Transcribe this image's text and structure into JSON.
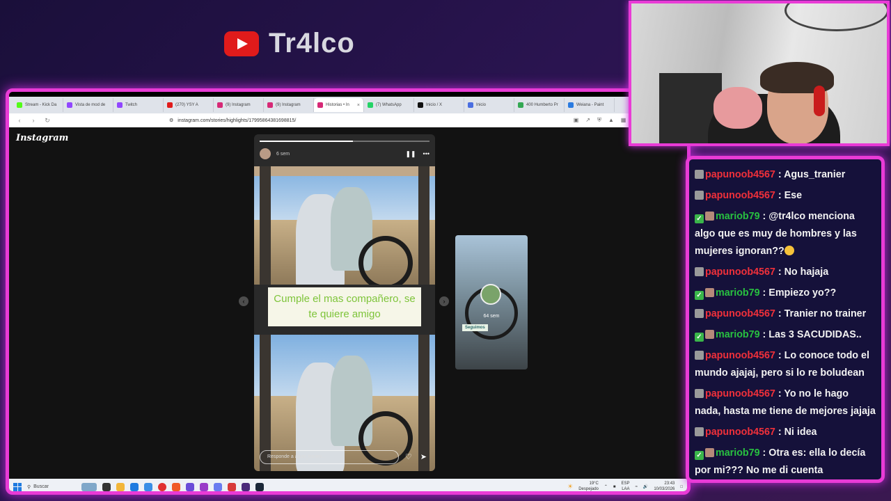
{
  "brand": {
    "name": "Tr4lco",
    "icon": "youtube-icon",
    "accent": "#e01b1b"
  },
  "frame_color": "#e93bd6",
  "browser": {
    "tabs": [
      {
        "label": "Stream - Kick Da",
        "color": "#53fc18",
        "active": false
      },
      {
        "label": "Vista de mod de",
        "color": "#9146ff",
        "active": false
      },
      {
        "label": "Twitch",
        "color": "#9146ff",
        "active": false
      },
      {
        "label": "(270) YSY A",
        "color": "#e01b1b",
        "active": false
      },
      {
        "label": "(9) Instagram",
        "color": "#d62976",
        "active": false
      },
      {
        "label": "(9) Instagram",
        "color": "#d62976",
        "active": false
      },
      {
        "label": "Historias • In",
        "color": "#d62976",
        "active": true
      },
      {
        "label": "(7) WhatsApp",
        "color": "#25d366",
        "active": false
      },
      {
        "label": "Inicio / X",
        "color": "#111111",
        "active": false
      },
      {
        "label": "Inicio",
        "color": "#4a6ee0",
        "active": false
      },
      {
        "label": "400 Humberto Pr",
        "color": "#34a853",
        "active": false
      },
      {
        "label": "Weiana - Paint",
        "color": "#2b7be0",
        "active": false
      }
    ],
    "url": "instagram.com/stories/highlights/17995864381698815/"
  },
  "instagram": {
    "logo": "Instagram",
    "story": {
      "time": "6 sem",
      "caption": "Cumple el mas compañero, se te quiere amigo",
      "reply_placeholder": "Responde a agus_tranier...",
      "progress": 0.55
    },
    "next_story": {
      "time": "64 sem",
      "tag": "Seguimos"
    }
  },
  "taskbar": {
    "search": "Buscar",
    "weather_temp": "19°C",
    "weather_desc": "Despejado",
    "lang": "ESP",
    "layout": "LAA",
    "time": "23:43",
    "date": "10/03/2026"
  },
  "chat": [
    {
      "user": "papunoob4567",
      "color": "red",
      "badges": [
        "gray"
      ],
      "text": "Agus_tranier"
    },
    {
      "user": "papunoob4567",
      "color": "red",
      "badges": [
        "gray"
      ],
      "text": "Ese"
    },
    {
      "user": "mariob79",
      "color": "green",
      "badges": [
        "check",
        "pic"
      ],
      "text": "@tr4lco menciona algo que es muy de hombres y las mujeres ignoran??",
      "emoji": true
    },
    {
      "user": "papunoob4567",
      "color": "red",
      "badges": [
        "gray"
      ],
      "text": "No hajaja"
    },
    {
      "user": "mariob79",
      "color": "green",
      "badges": [
        "check",
        "pic"
      ],
      "text": "Empiezo yo??"
    },
    {
      "user": "papunoob4567",
      "color": "red",
      "badges": [
        "gray"
      ],
      "text": "Tranier no trainer"
    },
    {
      "user": "mariob79",
      "color": "green",
      "badges": [
        "check",
        "pic"
      ],
      "text": "Las 3 SACUDIDAS.."
    },
    {
      "user": "papunoob4567",
      "color": "red",
      "badges": [
        "gray"
      ],
      "text": "Lo conoce todo el mundo ajajaj, pero si lo re boludean"
    },
    {
      "user": "papunoob4567",
      "color": "red",
      "badges": [
        "gray"
      ],
      "text": "Yo no le hago nada, hasta me tiene de mejores jajaja"
    },
    {
      "user": "papunoob4567",
      "color": "red",
      "badges": [
        "gray"
      ],
      "text": "Ni idea"
    },
    {
      "user": "mariob79",
      "color": "green",
      "badges": [
        "check",
        "pic"
      ],
      "text": "Otra es: ella lo decía por mi??? No me di cuenta"
    }
  ]
}
